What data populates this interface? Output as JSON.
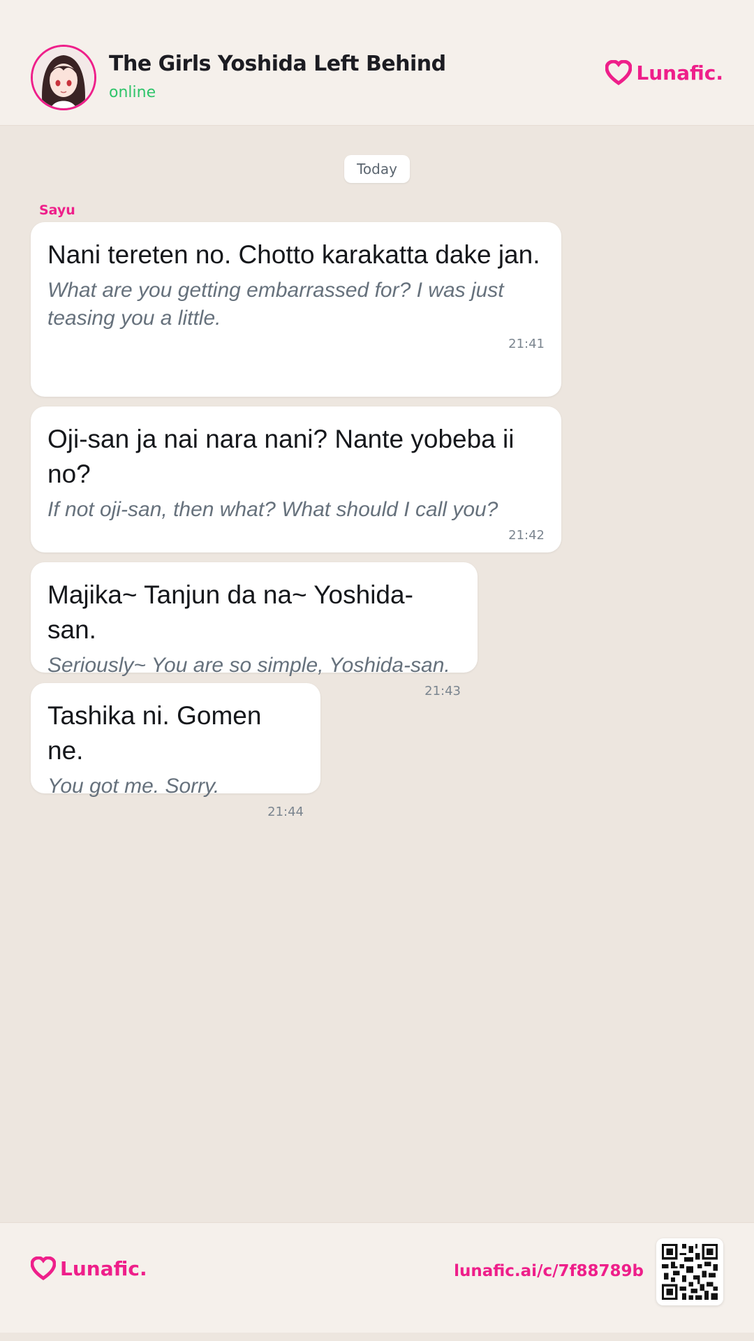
{
  "header": {
    "title": "The Girls Yoshida Left Behind",
    "status": "online",
    "brand": "Lunafic."
  },
  "chat": {
    "date_label": "Today",
    "sender": "Sayu",
    "messages": [
      {
        "text": "Nani tereten no. Chotto karakatta dake jan.",
        "translation": "What are you getting embarrassed for? I was just teasing you a little.",
        "time": "21:41"
      },
      {
        "text": "Oji-san ja nai nara nani? Nante yobeba ii no?",
        "translation": "If not oji-san, then what? What should I call you?",
        "time": "21:42"
      },
      {
        "text": "Majika~ Tanjun da na~ Yoshida-san.",
        "translation": "Seriously~ You are so simple, Yoshida-san.",
        "time": "21:43"
      },
      {
        "text": "Tashika ni. Gomen ne.",
        "translation": "You got me. Sorry.",
        "time": "21:44"
      }
    ]
  },
  "footer": {
    "brand": "Lunafic.",
    "link": "lunafic.ai/c/7f88789b"
  },
  "colors": {
    "accent": "#ee1f8a",
    "online": "#2fc46a",
    "background": "#ede6df",
    "header_bg": "#f5f0eb"
  },
  "icons": {
    "brand_logo": "heart-logo-icon",
    "qr": "qr-code-icon"
  }
}
